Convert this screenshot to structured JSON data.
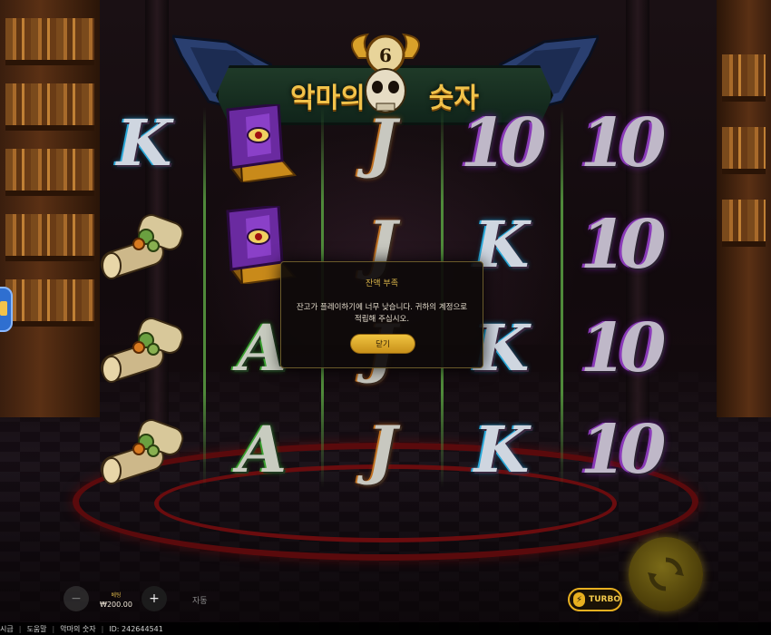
{
  "logo": {
    "title_part1": "악마의",
    "title_part2": "숫자",
    "skull_number": "6"
  },
  "reels": {
    "columns": [
      [
        "K",
        "scroll",
        "scroll",
        "scroll"
      ],
      [
        "tome",
        "tome",
        "A",
        "A"
      ],
      [
        "J",
        "J",
        "J",
        "J"
      ],
      [
        "10",
        "K",
        "K",
        "K"
      ],
      [
        "10",
        "10",
        "10",
        "10"
      ]
    ]
  },
  "dialog": {
    "title": "잔액 부족",
    "message": "잔고가 플레이하기에 너무 낮습니다. 귀하의 계정으로 적립해 주십시오.",
    "button": "닫기"
  },
  "controls": {
    "bet_label": "베팅",
    "bet_value": "₩200.00",
    "minus": "−",
    "plus": "+",
    "auto": "자동",
    "turbo": "TURBO"
  },
  "footer": {
    "clipped": "시급",
    "help": "도움말",
    "game_name": "악마의 숫자",
    "id": "ID: 242644541"
  },
  "colors": {
    "accent_gold": "#f2c24a",
    "reel_divider": "#4f8a3a",
    "dialog_border": "#6a5a2a"
  }
}
